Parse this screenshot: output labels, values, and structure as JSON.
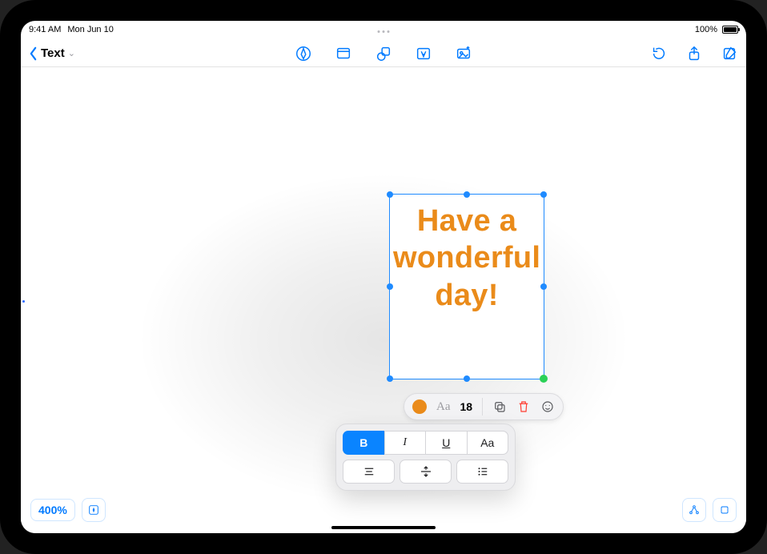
{
  "status": {
    "time": "9:41 AM",
    "date": "Mon Jun 10",
    "battery_pct": "100%"
  },
  "toolbar": {
    "back_label": "",
    "title": "Text",
    "tools": {
      "pen": "pen-icon",
      "note": "sticky-note-icon",
      "shape": "shape-icon",
      "text": "text-box-icon",
      "image": "image-icon",
      "undo": "undo-icon",
      "share": "share-icon",
      "compose": "compose-icon"
    }
  },
  "textbox": {
    "content": "Have a wonderful day!",
    "color": "#ea8b1a"
  },
  "context_pill": {
    "font_hint": "Aa",
    "font_size": "18"
  },
  "format_panel": {
    "bold": "B",
    "italic": "I",
    "underline": "U",
    "case": "Aa"
  },
  "bottom": {
    "zoom": "400%"
  }
}
